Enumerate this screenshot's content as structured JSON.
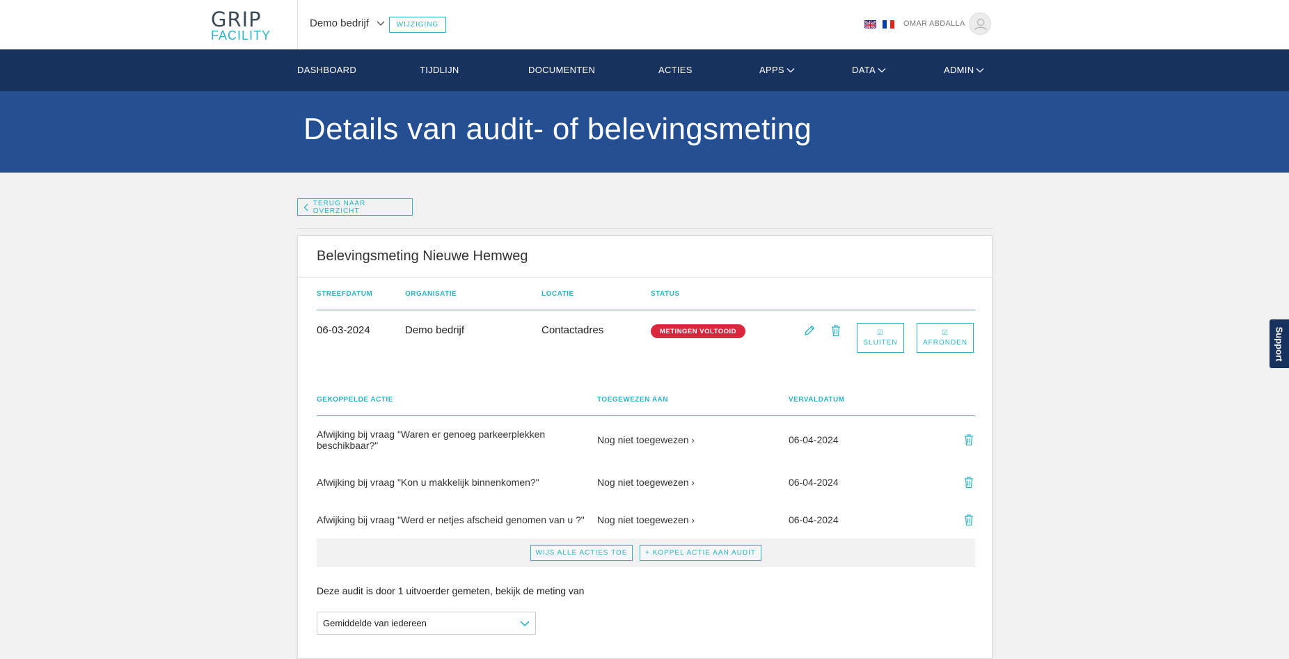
{
  "header": {
    "logo_line1": "GRIP",
    "logo_line2": "FACILITY",
    "company": "Demo bedrijf",
    "change_label": "WIJZIGING",
    "user_name": "OMAR ABDALLA"
  },
  "nav": {
    "items": [
      {
        "label": "DASHBOARD"
      },
      {
        "label": "TIJDLIJN"
      },
      {
        "label": "DOCUMENTEN"
      },
      {
        "label": "ACTIES"
      },
      {
        "label": "APPS"
      },
      {
        "label": "DATA"
      },
      {
        "label": "ADMIN"
      }
    ]
  },
  "page": {
    "title": "Details van audit- of belevingsmeting",
    "back_label": "TERUG NAAR OVERZICHT"
  },
  "audit": {
    "title": "Belevingsmeting Nieuwe Hemweg",
    "headers": {
      "target_date": "STREEFDATUM",
      "organization": "ORGANISATIE",
      "location": "LOCATIE",
      "status": "STATUS"
    },
    "target_date": "06-03-2024",
    "organization": "Demo bedrijf",
    "location": "Contactadres",
    "status": "METINGEN VOLTOOID",
    "close_label": "SLUITEN",
    "finish_label": "AFRONDEN"
  },
  "actions": {
    "headers": {
      "action": "GEKOPPELDE ACTIE",
      "assigned": "TOEGEWEZEN AAN",
      "due": "VERVALDATUM"
    },
    "rows": [
      {
        "action_line1": "Afwijking bij vraag \"Waren er genoeg parkeerplekken",
        "action_line2": "beschikbaar?\"",
        "assigned": "Nog niet toegewezen",
        "due": "06-04-2024"
      },
      {
        "action_line1": "Afwijking bij vraag \"Kon u makkelijk binnenkomen?\"",
        "action_line2": "",
        "assigned": "Nog niet toegewezen",
        "due": "06-04-2024"
      },
      {
        "action_line1": "Afwijking bij vraag \"Werd er netjes afscheid genomen van u ?\"",
        "action_line2": "",
        "assigned": "Nog niet toegewezen",
        "due": "06-04-2024"
      }
    ],
    "assign_all_label": "WIJS ALLE ACTIES TOE",
    "link_action_label": "+ KOPPEL ACTIE AAN AUDIT"
  },
  "measurement": {
    "text": "Deze audit is door 1 uitvoerder gemeten, bekijk de meting van",
    "select_value": "Gemiddelde van iedereen"
  },
  "support_label": "Support",
  "colors": {
    "teal": "#2bb3c6",
    "navy": "#17325e",
    "banner": "#244f93",
    "status_red": "#d9283d"
  }
}
